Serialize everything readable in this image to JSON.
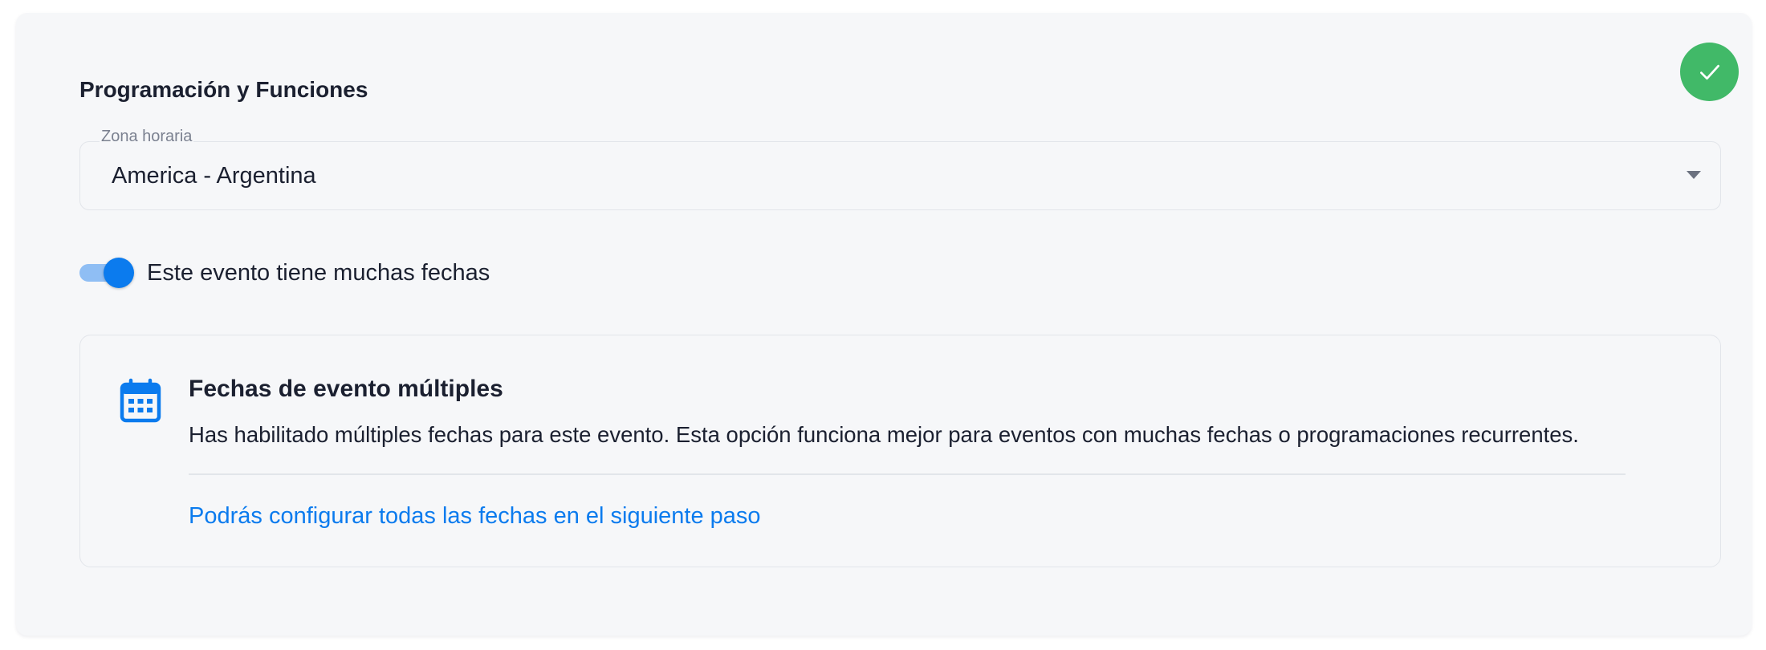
{
  "section": {
    "title": "Programación y Funciones"
  },
  "timezone": {
    "label": "Zona horaria",
    "value": "America - Argentina"
  },
  "multi_dates_toggle": {
    "label": "Este evento tiene muchas fechas",
    "checked": true
  },
  "info_panel": {
    "title": "Fechas de evento múltiples",
    "description": "Has habilitado múltiples fechas para este evento. Esta opción funciona mejor para eventos con muchas fechas o programaciones recurrentes.",
    "link": "Podrás configurar todas las fechas en el siguiente paso"
  },
  "colors": {
    "accent": "#0b7bee",
    "success": "#41b968",
    "text": "#1b2030",
    "card_background": "#f6f7f9"
  },
  "icons": {
    "status": "check-icon",
    "select": "chevron-down-icon",
    "info": "calendar-icon"
  }
}
